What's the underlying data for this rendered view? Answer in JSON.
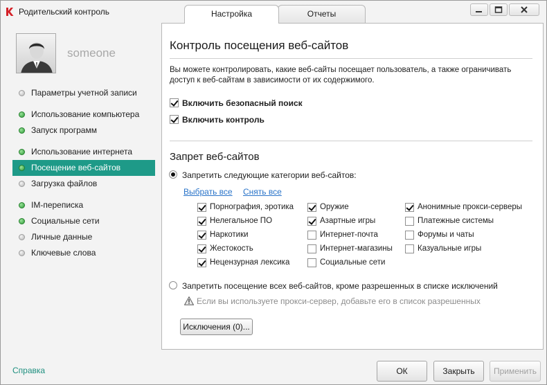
{
  "window": {
    "title": "Родительский контроль"
  },
  "tabs": [
    {
      "label": "Настройка",
      "active": true
    },
    {
      "label": "Отчеты",
      "active": false
    }
  ],
  "sidebar": {
    "username": "someone",
    "items": [
      {
        "label": "Параметры учетной записи",
        "status": "gray"
      },
      {
        "label": "Использование компьютера",
        "status": "green"
      },
      {
        "label": "Запуск программ",
        "status": "green"
      },
      {
        "label": "Использование интернета",
        "status": "green"
      },
      {
        "label": "Посещение веб-сайтов",
        "status": "green",
        "active": true
      },
      {
        "label": "Загрузка файлов",
        "status": "gray"
      },
      {
        "label": "IM-переписка",
        "status": "green"
      },
      {
        "label": "Социальные сети",
        "status": "green"
      },
      {
        "label": "Личные данные",
        "status": "gray"
      },
      {
        "label": "Ключевые слова",
        "status": "gray"
      }
    ]
  },
  "main": {
    "title": "Контроль посещения веб-сайтов",
    "description": "Вы можете контролировать, какие веб-сайты посещает пользователь, а также ограничивать доступ к веб-сайтам в зависимости от их содержимого.",
    "safe_search": {
      "label": "Включить безопасный поиск",
      "checked": true
    },
    "enable_control": {
      "label": "Включить контроль",
      "checked": true
    },
    "block_section_title": "Запрет веб-сайтов",
    "block_categories_option": {
      "label": "Запретить следующие категории веб-сайтов:",
      "selected": true
    },
    "select_all_label": "Выбрать все",
    "clear_all_label": "Снять все",
    "categories": [
      {
        "label": "Порнография, эротика",
        "checked": true
      },
      {
        "label": "Нелегальное ПО",
        "checked": true
      },
      {
        "label": "Наркотики",
        "checked": true
      },
      {
        "label": "Жестокость",
        "checked": true
      },
      {
        "label": "Нецензурная лексика",
        "checked": true
      },
      {
        "label": "Оружие",
        "checked": true
      },
      {
        "label": "Азартные игры",
        "checked": true
      },
      {
        "label": "Интернет-почта",
        "checked": false
      },
      {
        "label": "Интернет-магазины",
        "checked": false
      },
      {
        "label": "Социальные сети",
        "checked": false
      },
      {
        "label": "Анонимные прокси-серверы",
        "checked": true
      },
      {
        "label": "Платежные системы",
        "checked": false
      },
      {
        "label": "Форумы и чаты",
        "checked": false
      },
      {
        "label": "Казуальные игры",
        "checked": false
      }
    ],
    "block_all_option": {
      "label": "Запретить посещение всех веб-сайтов, кроме разрешенных в списке исключений",
      "selected": false
    },
    "proxy_note": "Если вы используете прокси-сервер, добавьте его в список разрешенных",
    "exclusions_button": "Исключения (0)..."
  },
  "footer": {
    "help_label": "Справка",
    "ok_label": "ОК",
    "close_label": "Закрыть",
    "apply_label": "Применить"
  },
  "colors": {
    "accent": "#1e9a88",
    "link": "#2a74c9",
    "status_green": "#2e9a37",
    "status_gray": "#b5b5b5"
  }
}
